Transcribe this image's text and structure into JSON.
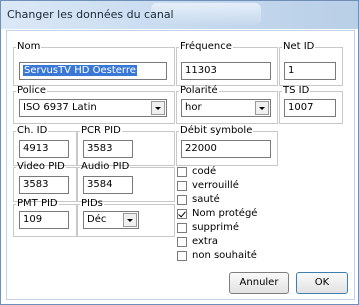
{
  "window": {
    "title": "Changer les données du canal"
  },
  "fields": {
    "nom": {
      "label": "Nom",
      "value": "ServusTV HD Oesterre"
    },
    "frequence": {
      "label": "Fréquence",
      "value": "11303"
    },
    "net_id": {
      "label": "Net ID",
      "value": "1"
    },
    "police": {
      "label": "Police",
      "value": "ISO 6937 Latin"
    },
    "polarite": {
      "label": "Polarité",
      "value": "hor"
    },
    "ts_id": {
      "label": "TS ID",
      "value": "1007"
    },
    "ch_id": {
      "label": "Ch. ID",
      "value": "4913"
    },
    "pcr_pid": {
      "label": "PCR PID",
      "value": "3583"
    },
    "debit_symbole": {
      "label": "Débit symbole",
      "value": "22000"
    },
    "video_pid": {
      "label": "Video PID",
      "value": "3583"
    },
    "audio_pid": {
      "label": "Audio PID",
      "value": "3584"
    },
    "pmt_pid": {
      "label": "PMT PID",
      "value": "109"
    },
    "pids": {
      "label": "PIDs",
      "value": "Déc"
    }
  },
  "flags": [
    {
      "label": "codé",
      "checked": false
    },
    {
      "label": "verrouillé",
      "checked": false
    },
    {
      "label": "sauté",
      "checked": false
    },
    {
      "label": "Nom protégé",
      "checked": true
    },
    {
      "label": "supprimé",
      "checked": false
    },
    {
      "label": "extra",
      "checked": false
    },
    {
      "label": "non souhaité",
      "checked": false
    }
  ],
  "buttons": {
    "cancel": "Annuler",
    "ok": "OK"
  }
}
